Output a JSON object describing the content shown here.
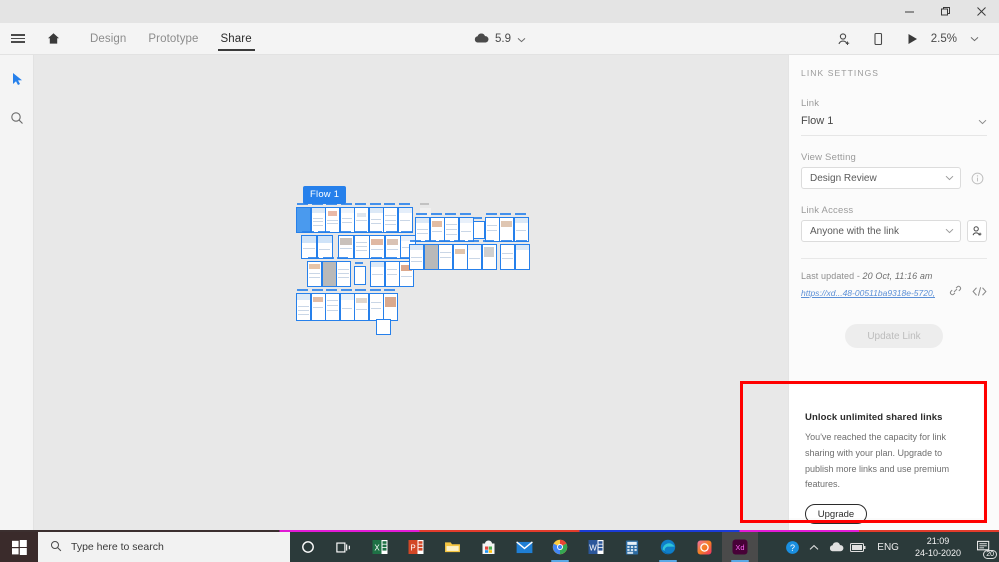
{
  "window": {
    "controls": [
      {
        "name": "minimize-button",
        "glyph": "minimize"
      },
      {
        "name": "restore-button",
        "glyph": "restore"
      },
      {
        "name": "close-button",
        "glyph": "close"
      }
    ]
  },
  "menubar": {
    "hamburger": "hamburger-menu-icon",
    "home": "home-icon",
    "tabs": [
      {
        "label": "Design",
        "active": false
      },
      {
        "label": "Prototype",
        "active": false
      },
      {
        "label": "Share",
        "active": true
      }
    ],
    "cloud_icon": "cloud-icon",
    "cloud_version": "5.9",
    "cloud_chevron": "chevron-down-icon",
    "tools": [
      {
        "name": "invite-user-icon"
      },
      {
        "name": "device-preview-icon"
      },
      {
        "name": "play-preview-icon"
      }
    ],
    "zoom_level": "2.5%",
    "zoom_chevron": "chevron-down-icon"
  },
  "toolrail": {
    "tools": [
      {
        "name": "select-tool",
        "label": "Select",
        "active": true
      },
      {
        "name": "zoom-tool",
        "label": "Zoom",
        "active": false
      }
    ]
  },
  "canvas": {
    "flow_label": "Flow 1"
  },
  "panel": {
    "title": "LINK SETTINGS",
    "link": {
      "label": "Link",
      "value": "Flow 1",
      "chevron": "chevron-down-icon"
    },
    "view_setting": {
      "label": "View Setting",
      "value": "Design Review",
      "chevron": "chevron-down-icon",
      "info_icon": "info-icon"
    },
    "link_access": {
      "label": "Link Access",
      "value": "Anyone with the link",
      "chevron": "chevron-down-icon",
      "side_icon": "add-person-icon"
    },
    "last_updated_prefix": "Last updated - ",
    "last_updated_time": "20 Oct, 11:16 am",
    "url": "https://xd...48-00511ba9318e-5720,",
    "url_icons": [
      {
        "name": "copy-link-icon"
      },
      {
        "name": "embed-code-icon"
      }
    ],
    "update_button": "Update Link"
  },
  "upsell": {
    "title": "Unlock unlimited shared links",
    "body": "You've reached the capacity for link sharing with your plan. Upgrade to publish more links and use premium features.",
    "button": "Upgrade",
    "highlight_color": "#ff0000"
  },
  "taskbar": {
    "start": "windows-start-icon",
    "search_placeholder": "Type here to search",
    "search_icon": "search-icon",
    "items": [
      {
        "name": "cortana-icon",
        "glyph": "circle"
      },
      {
        "name": "task-view-icon",
        "glyph": "taskview"
      },
      {
        "name": "excel-icon",
        "glyph": "X"
      },
      {
        "name": "powerpoint-icon",
        "glyph": "P"
      },
      {
        "name": "file-explorer-icon",
        "glyph": "folder"
      },
      {
        "name": "microsoft-store-icon",
        "glyph": "store"
      },
      {
        "name": "mail-icon",
        "glyph": "mail"
      },
      {
        "name": "chrome-icon",
        "glyph": "chrome"
      },
      {
        "name": "word-icon",
        "glyph": "W"
      },
      {
        "name": "calculator-icon",
        "glyph": "calc"
      },
      {
        "name": "edge-icon",
        "glyph": "edge"
      },
      {
        "name": "creative-cloud-icon",
        "glyph": "cc"
      },
      {
        "name": "adobe-xd-icon",
        "glyph": "Xd"
      }
    ],
    "tray": {
      "help_icon": "help-question-icon",
      "chevron_icon": "chevron-up-icon",
      "onedrive_icon": "cloud-icon",
      "battery_icon": "battery-icon",
      "language": "ENG",
      "time": "21:09",
      "date": "24-10-2020",
      "notification_icon": "notifications-icon",
      "notification_count": "20"
    }
  },
  "colors": {
    "accent_blue": "#2680eb",
    "canvas_gray": "#e8e8e8",
    "panel_bg": "#fbfbfb",
    "taskbar_bg": "#2b3a3a",
    "highlight_red": "#ff0000",
    "link_blue": "#5b8fd6"
  }
}
